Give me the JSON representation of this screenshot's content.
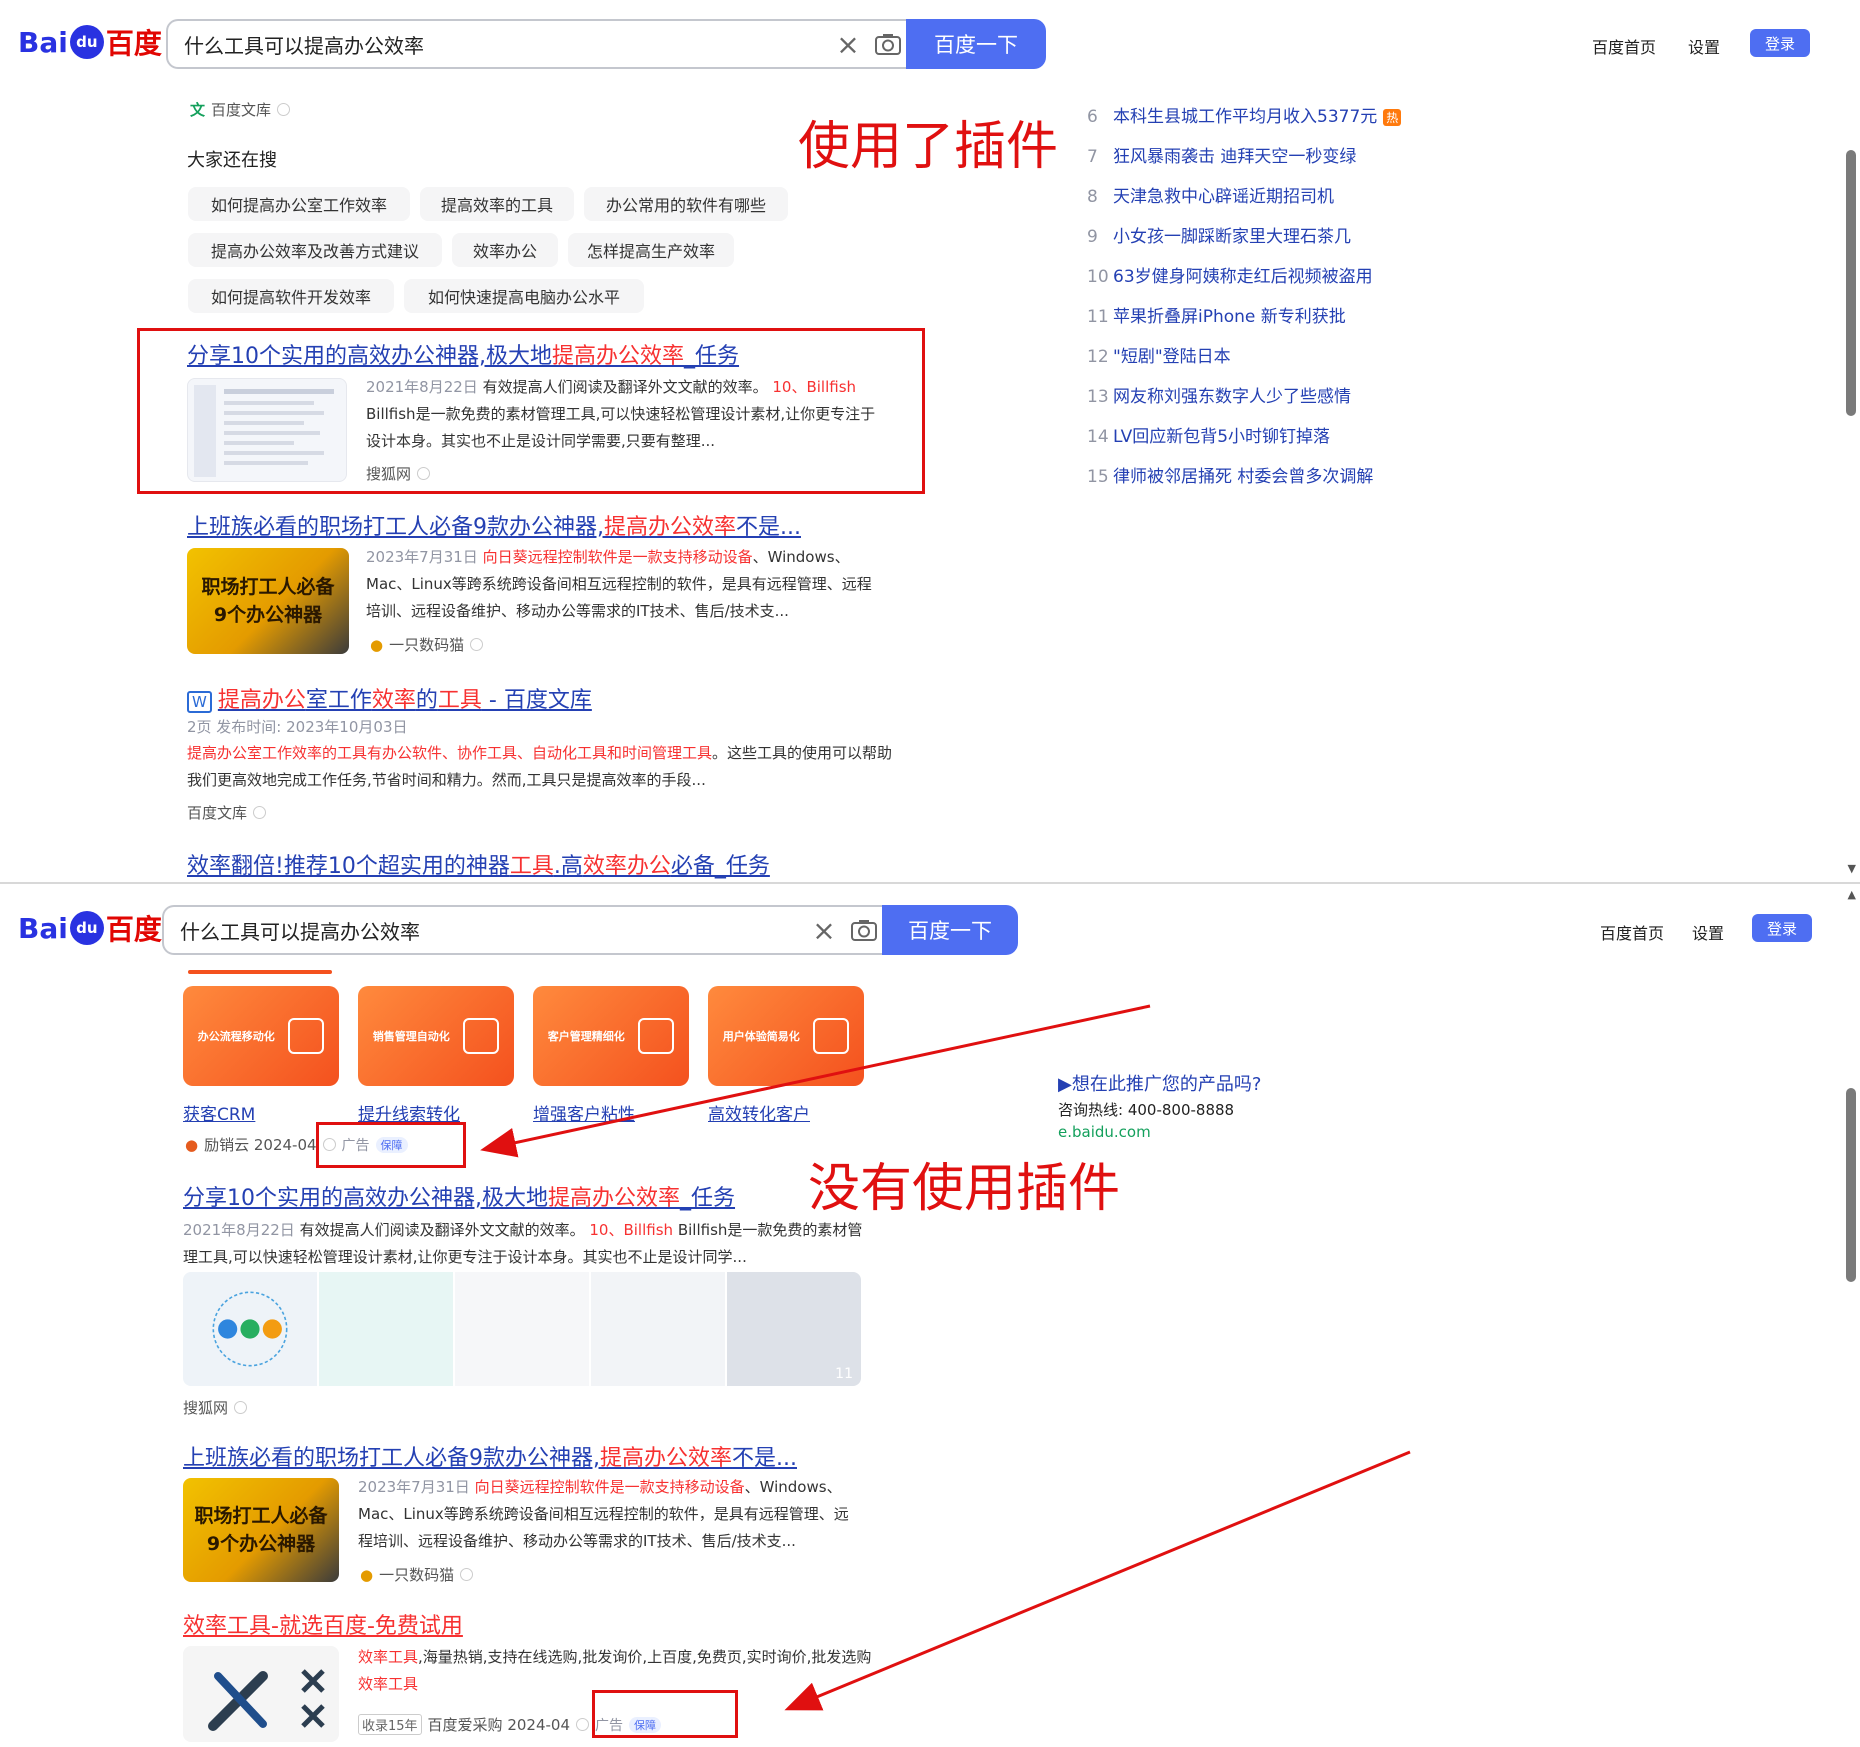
{
  "header": {
    "logo_latin": "Bai",
    "logo_paw": "du",
    "logo_cn": "百度",
    "query": "什么工具可以提高办公效率",
    "search_button": "百度一下",
    "home_link": "百度首页",
    "settings_link": "设置",
    "login_button": "登录"
  },
  "top": {
    "doc_source": "百度文库",
    "related_heading": "大家还在搜",
    "related_tags": [
      "如何提高办公室工作效率",
      "提高效率的工具",
      "办公常用的软件有哪些",
      "提高办公效率及改善方式建议",
      "效率办公",
      "怎样提高生产效率",
      "如何提高软件开发效率",
      "如何快速提高电脑办公水平"
    ],
    "annotation": "使用了插件",
    "result1": {
      "title_a": "分享10个实用的高效办公神器,极大地",
      "title_b": "提高办公效率",
      "title_c": "_任务",
      "date": "2021年8月22日",
      "text_a": "有效提高人们阅读及翻译外文文献的效率。",
      "text_red": "10、Billfish",
      "text_b": "Billfish是一款免费的素材管理工具,可以快速轻松管理设计素材,让你更专注于设计本身。其实也不止是设计同学需要,只要有整理...",
      "source": "搜狐网"
    },
    "result2": {
      "title_a": "上班族必看的职场打工人必备9款办公神器,",
      "title_b": "提高办公效率",
      "title_c": "不是...",
      "thumb_line1": "职场打工人必备",
      "thumb_line2": "9个办公神器",
      "date": "2023年7月31日",
      "text_red": "向日葵远程控制软件是一款支持移动设备",
      "text_b": "、Windows、Mac、Linux等跨系统跨设备间相互远程控制的软件，是具有远程管理、远程培训、远程设备维护、移动办公等需求的IT技术、售后/技术支...",
      "source": "一只数码猫"
    },
    "result3": {
      "badge": "W",
      "t1": "提高办公",
      "t2": "室工作",
      "t3": "效率",
      "t4": "的",
      "t5": "工具",
      "t6": " - 百度文库",
      "meta": "2页 发布时间: 2023年10月03日",
      "text_red": "提高办公室工作效率的工具有办公软件、协作工具、自动化工具和时间管理工具",
      "text_b": "。这些工具的使用可以帮助我们更高效地完成工作任务,节省时间和精力。然而,工具只是提高效率的手段...",
      "source": "百度文库"
    },
    "result4": {
      "t1": "效率翻倍!推荐10个超实用的神器",
      "t2": "工具",
      "t3": ".高",
      "t4": "效率办公",
      "t5": "必备_任务"
    },
    "hot_list": [
      {
        "num": "6",
        "text": "本科生县城工作平均月收入5377元",
        "hot": "热"
      },
      {
        "num": "7",
        "text": "狂风暴雨袭击 迪拜天空一秒变绿"
      },
      {
        "num": "8",
        "text": "天津急救中心辟谣近期招司机"
      },
      {
        "num": "9",
        "text": "小女孩一脚踩断家里大理石茶几"
      },
      {
        "num": "10",
        "text": "63岁健身阿姨称走红后视频被盗用"
      },
      {
        "num": "11",
        "text": "苹果折叠屏iPhone 新专利获批"
      },
      {
        "num": "12",
        "text": "\"短剧\"登陆日本"
      },
      {
        "num": "13",
        "text": "网友称刘强东数字人少了些感情"
      },
      {
        "num": "14",
        "text": "LV回应新包背5小时铆钉掉落"
      },
      {
        "num": "15",
        "text": "律师被邻居捅死 村委会曾多次调解"
      }
    ]
  },
  "bottom": {
    "annotation": "没有使用插件",
    "ad_cards": [
      {
        "inner": "办公流程移动化",
        "label": "获客CRM"
      },
      {
        "inner": "销售管理自动化",
        "label": "提升线索转化"
      },
      {
        "inner": "客户管理精细化",
        "label": "增强客户粘性"
      },
      {
        "inner": "用户体验简易化",
        "label": "高效转化客户"
      }
    ],
    "ad_source": "励销云 2024-04",
    "ad_tag": "广告",
    "bao_tag": "保障",
    "promo": {
      "title": "▶想在此推广您的产品吗?",
      "hotline": "咨询热线: 400-800-8888",
      "site": "e.baidu.com"
    },
    "result1": {
      "title_a": "分享10个实用的高效办公神器,极大地",
      "title_b": "提高办公效率",
      "title_c": "_任务",
      "date": "2021年8月22日",
      "text_a": "有效提高人们阅读及翻译外文文献的效率。",
      "text_red": "10、Billfish",
      "text_b": "Billfish是一款免费的素材管理工具,可以快速轻松管理设计素材,让你更专注于设计本身。其实也不止是设计同学...",
      "image_count": "11",
      "source": "搜狐网"
    },
    "result2": {
      "title_a": "上班族必看的职场打工人必备9款办公神器,",
      "title_b": "提高办公效率",
      "title_c": "不是...",
      "thumb_line1": "职场打工人必备",
      "thumb_line2": "9个办公神器",
      "date": "2023年7月31日",
      "text_red": "向日葵远程控制软件是一款支持移动设备",
      "text_b": "、Windows、Mac、Linux等跨系统跨设备间相互远程控制的软件，是具有远程管理、远程培训、远程设备维护、移动办公等需求的IT技术、售后/技术支...",
      "source": "一只数码猫"
    },
    "ad2": {
      "title": "效率工具-就选百度-免费试用",
      "text_red1": "效率工具",
      "text_b": ",海量热销,支持在线选购,批发询价,上百度,免费页,实时询价,批发选购",
      "text_red2": "效率工具",
      "badge": "收录15年",
      "source": "百度爱采购 2024-04",
      "ad_tag": "广告",
      "bao_tag": "保障"
    }
  },
  "colors": {
    "link": "#2440b3",
    "highlight": "#f73131",
    "brand_blue": "#4e6ef2",
    "annotation_red": "#e01010"
  }
}
